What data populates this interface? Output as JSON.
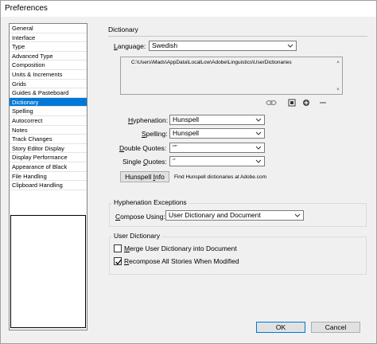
{
  "window": {
    "title": "Preferences"
  },
  "sidebar": {
    "items": [
      {
        "label": "General",
        "selected": false
      },
      {
        "label": "Interface",
        "selected": false
      },
      {
        "label": "Type",
        "selected": false
      },
      {
        "label": "Advanced Type",
        "selected": false
      },
      {
        "label": "Composition",
        "selected": false
      },
      {
        "label": "Units & Increments",
        "selected": false
      },
      {
        "label": "Grids",
        "selected": false
      },
      {
        "label": "Guides & Pasteboard",
        "selected": false
      },
      {
        "label": "Dictionary",
        "selected": true
      },
      {
        "label": "Spelling",
        "selected": false
      },
      {
        "label": "Autocorrect",
        "selected": false
      },
      {
        "label": "Notes",
        "selected": false
      },
      {
        "label": "Track Changes",
        "selected": false
      },
      {
        "label": "Story Editor Display",
        "selected": false
      },
      {
        "label": "Display Performance",
        "selected": false
      },
      {
        "label": "Appearance of Black",
        "selected": false
      },
      {
        "label": "File Handling",
        "selected": false
      },
      {
        "label": "Clipboard Handling",
        "selected": false
      }
    ]
  },
  "dictionary": {
    "section_title": "Dictionary",
    "language_label": "Language:",
    "language_value": "Swedish",
    "path": "C:\\Users\\Mads\\AppData\\LocalLow\\Adobe\\Linguistics\\UserDictionaries",
    "hyphenation_label": "Hyphenation:",
    "hyphenation_value": "Hunspell",
    "spelling_label": "Spelling:",
    "spelling_value": "Hunspell",
    "double_quotes_label": "Double Quotes:",
    "double_quotes_value": "“”",
    "single_quotes_label": "Single Quotes:",
    "single_quotes_value": "‘’",
    "hunspell_button": "Hunspell Info",
    "hunspell_note": "Find Hunspell dictionaries at Adobe.com"
  },
  "hyphenation_exceptions": {
    "title": "Hyphenation Exceptions",
    "compose_label": "Compose Using:",
    "compose_value": "User Dictionary and Document"
  },
  "user_dictionary": {
    "title": "User Dictionary",
    "merge_label": "Merge User Dictionary into Document",
    "merge_checked": false,
    "recompose_label": "Recompose All Stories When Modified",
    "recompose_checked": true
  },
  "footer": {
    "ok_label": "OK",
    "cancel_label": "Cancel"
  },
  "colors": {
    "selection": "#0078d7",
    "default_button_border": "#0078d7"
  },
  "icons": [
    "link-dictionary-icon",
    "new-dictionary-icon",
    "add-dictionary-icon",
    "remove-dictionary-icon",
    "chevron-down-icon"
  ]
}
